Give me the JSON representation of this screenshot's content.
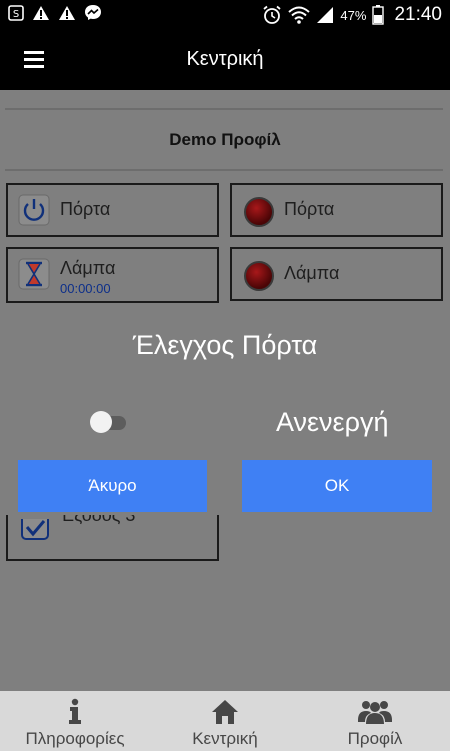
{
  "status_bar": {
    "battery_percent": "47%",
    "time": "21:40",
    "left_icons": [
      "app-notification-icon",
      "warning-icon",
      "warning-icon",
      "messenger-icon"
    ],
    "right_icons": [
      "alarm-icon",
      "wifi-icon",
      "signal-icon",
      "battery-icon"
    ]
  },
  "appbar": {
    "title": "Κεντρική",
    "menu_icon": "hamburger-icon"
  },
  "profile": {
    "name": "Demo Προφίλ"
  },
  "tiles": {
    "door_control": {
      "label": "Πόρτα",
      "icon": "power-icon"
    },
    "door_status": {
      "label": "Πόρτα",
      "icon": "red-led-icon"
    },
    "lamp_control": {
      "label": "Λάμπα",
      "timer": "00:00:00",
      "icon": "hourglass-icon"
    },
    "lamp_status": {
      "label": "Λάμπα",
      "icon": "red-led-icon"
    },
    "partial_tile": {
      "label": "Έξοδος 3",
      "icon": "checkbox-icon"
    }
  },
  "dialog": {
    "title": "Έλεγχος Πόρτα",
    "toggle_on": false,
    "state_text": "Ανενεργή",
    "cancel_label": "Άκυρο",
    "ok_label": "OK",
    "button_color": "#3f80f4"
  },
  "bottom_nav": {
    "items": [
      {
        "label": "Πληροφορίες",
        "icon": "info-icon"
      },
      {
        "label": "Κεντρική",
        "icon": "home-icon"
      },
      {
        "label": "Προφίλ",
        "icon": "users-icon"
      }
    ]
  }
}
